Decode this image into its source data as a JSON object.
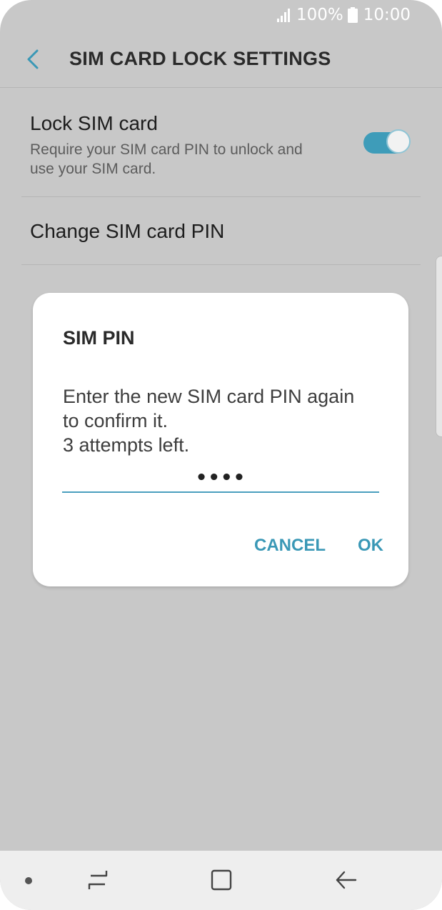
{
  "status_bar": {
    "battery": "100%",
    "time": "10:00"
  },
  "header": {
    "title": "SIM CARD LOCK SETTINGS"
  },
  "settings": {
    "lock_sim": {
      "title": "Lock SIM card",
      "description": "Require your SIM card PIN to unlock and use your SIM card.",
      "enabled": true
    },
    "change_pin": {
      "title": "Change SIM card PIN"
    }
  },
  "dialog": {
    "title": "SIM PIN",
    "message": "Enter the new SIM card PIN again\nto confirm it.\n3 attempts left.",
    "pin_value": "••••",
    "cancel_label": "CANCEL",
    "ok_label": "OK"
  },
  "colors": {
    "accent": "#3e9cb9",
    "background": "#c8c8c8",
    "dialog": "#ffffff"
  }
}
